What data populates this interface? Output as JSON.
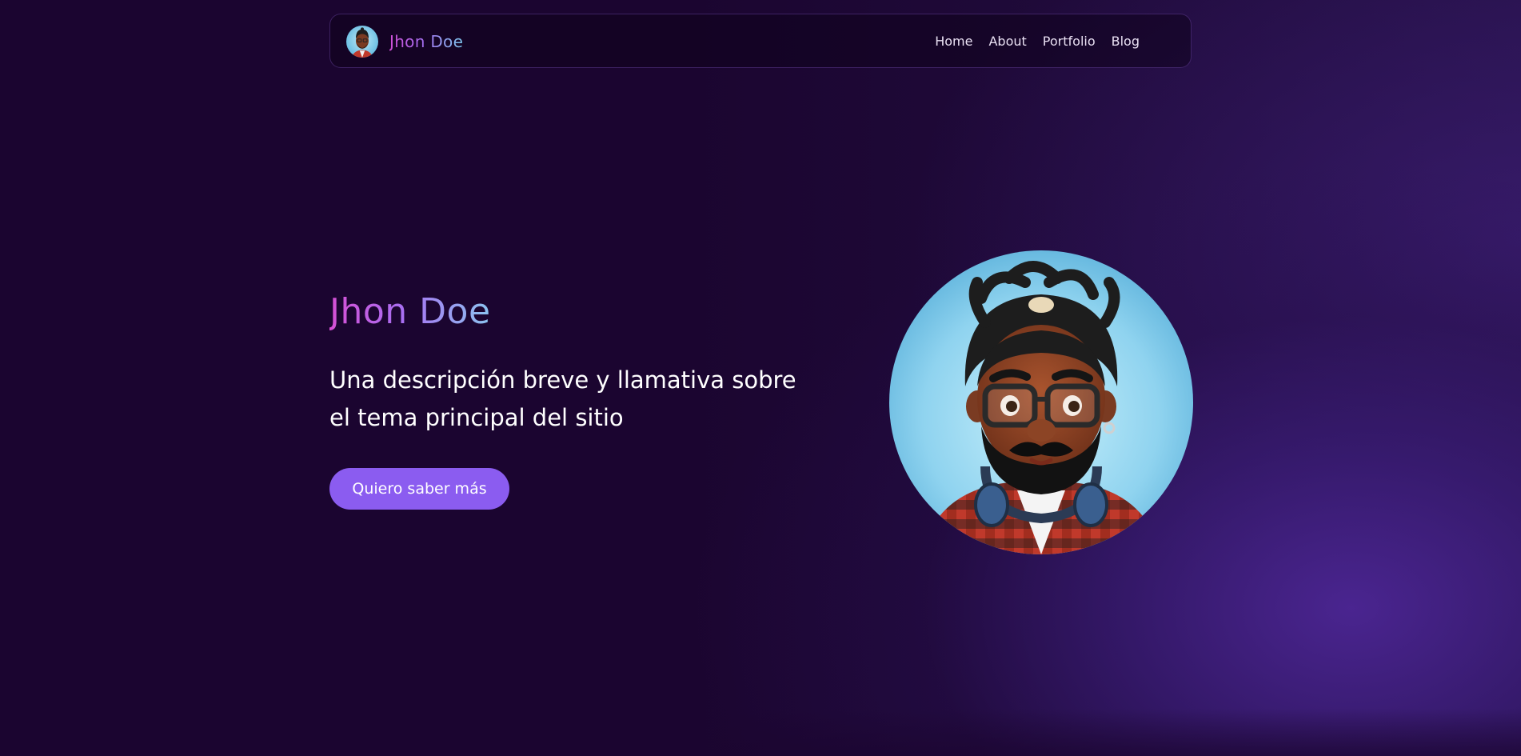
{
  "navbar": {
    "brand_name": "Jhon Doe",
    "links": [
      {
        "label": "Home"
      },
      {
        "label": "About"
      },
      {
        "label": "Portfolio"
      },
      {
        "label": "Blog"
      }
    ]
  },
  "hero": {
    "title": "Jhon Doe",
    "description": "Una descripción breve y llamativa sobre el tema principal del sitio",
    "cta_label": "Quiero saber más"
  },
  "colors": {
    "background": "#1b0530",
    "accent_button": "#8b5cf0",
    "gradient_pink": "#d64fd4",
    "gradient_purple": "#a96ff2",
    "gradient_blue": "#8cc4f0",
    "glow_purple": "#4c2694"
  },
  "icons": {
    "brand_avatar": "avatar-portrait-icon",
    "hero_image": "avatar-portrait-illustration"
  }
}
